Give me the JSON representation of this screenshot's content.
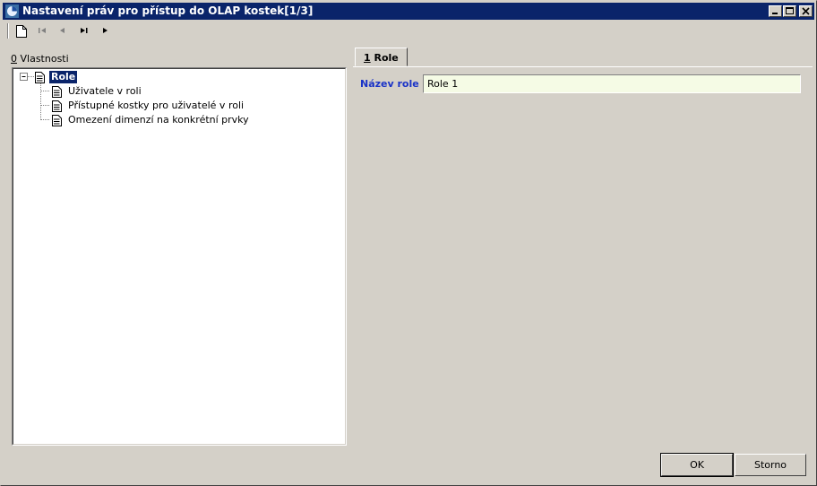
{
  "window": {
    "title": "Nastavení práv pro přístup do OLAP kostek[1/3]",
    "controls": [
      "minimize-icon",
      "maximize-icon",
      "close-icon"
    ]
  },
  "toolbar": {
    "buttons": [
      "new-document-icon",
      "first-record-icon",
      "previous-record-icon",
      "last-record-icon",
      "next-record-icon"
    ]
  },
  "left_panel": {
    "label_hotkey": "0",
    "label_text": " Vlastnosti",
    "tree": {
      "root": {
        "label": "Role",
        "expanded": true,
        "selected": true
      },
      "children": [
        {
          "label": "Uživatele v roli"
        },
        {
          "label": "Přístupné kostky pro uživatelé v roli"
        },
        {
          "label": "Omezení dimenzí na konkrétní prvky"
        }
      ]
    }
  },
  "right_panel": {
    "tab": {
      "hotkey": "1",
      "label": " Role"
    },
    "field": {
      "label": "Název role",
      "value": "Role 1"
    }
  },
  "buttons": {
    "ok": "OK",
    "cancel": "Storno"
  },
  "colors": {
    "title_bar": "#0a246a",
    "field_label": "#1a33c7",
    "input_bg": "#f5fbe5",
    "face": "#d4d0c8"
  }
}
